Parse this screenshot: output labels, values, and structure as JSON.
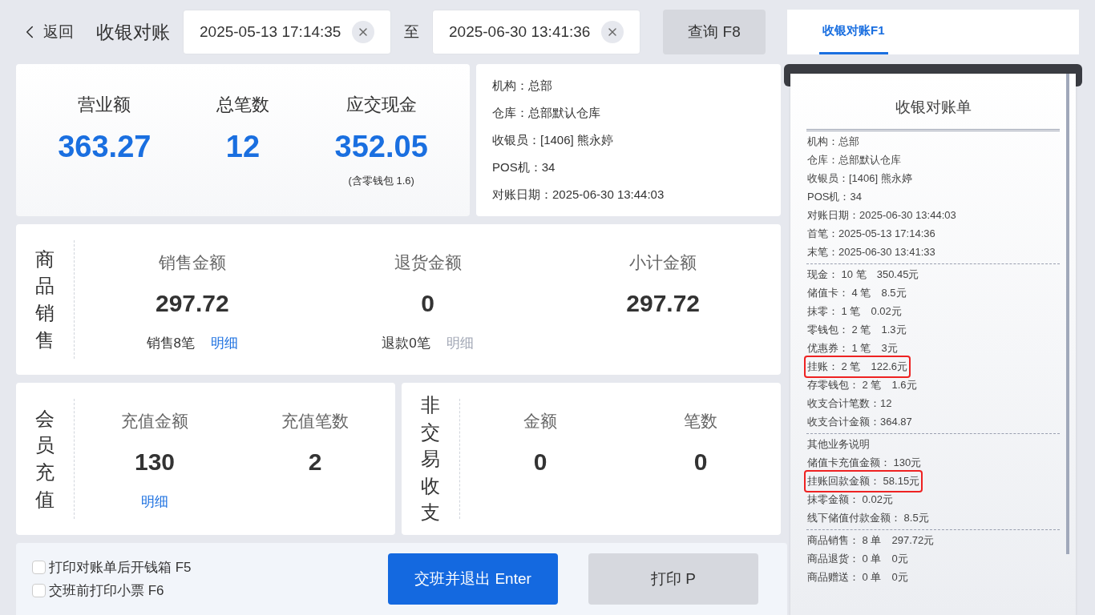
{
  "header": {
    "back": "返回",
    "title": "收银对账",
    "date_from": "2025-05-13 17:14:35",
    "separator": "至",
    "date_to": "2025-06-30 13:41:36",
    "query_button": "查询 F8"
  },
  "summary": [
    {
      "label": "营业额",
      "value": "363.27"
    },
    {
      "label": "总笔数",
      "value": "12"
    },
    {
      "label": "应交现金",
      "value": "352.05",
      "note": "(含零钱包 1.6)"
    }
  ],
  "info": [
    "机构：总部",
    "仓库：总部默认仓库",
    "收银员：[1406] 熊永婷",
    "POS机：34",
    "对账日期：2025-06-30 13:44:03"
  ],
  "goods_sales": {
    "label": "商品销售",
    "columns": [
      {
        "label": "销售金额",
        "value": "297.72",
        "count": "销售8笔",
        "link": "明细",
        "disabled": false
      },
      {
        "label": "退货金额",
        "value": "0",
        "count": "退款0笔",
        "link": "明细",
        "disabled": true
      },
      {
        "label": "小计金额",
        "value": "297.72"
      }
    ]
  },
  "member_recharge": {
    "label": "会员充值",
    "columns": [
      {
        "label": "充值金额",
        "value": "130",
        "link": "明细",
        "disabled": false
      },
      {
        "label": "充值笔数",
        "value": "2"
      }
    ]
  },
  "non_trade": {
    "label": "非交易收支",
    "columns": [
      {
        "label": "金额",
        "value": "0"
      },
      {
        "label": "笔数",
        "value": "0"
      }
    ]
  },
  "options": [
    {
      "label": "打印对账单后开钱箱 F5",
      "checked": false
    },
    {
      "label": "交班前打印小票 F6",
      "checked": false
    }
  ],
  "buttons": [
    {
      "label": "交班并退出 Enter",
      "kind": "primary"
    },
    {
      "label": "打印 P",
      "kind": "secondary"
    }
  ],
  "tabs": [
    {
      "label": "收银对账F1",
      "selected": true
    }
  ],
  "receipt": {
    "title": "收银对账单",
    "sections": [
      {
        "lines": [
          {
            "text": "机构：总部",
            "highlighted": false
          },
          {
            "text": "仓库：总部默认仓库",
            "highlighted": false
          },
          {
            "text": "收银员：[1406] 熊永婷",
            "highlighted": false
          },
          {
            "text": "POS机：34",
            "highlighted": false
          },
          {
            "text": "对账日期：2025-06-30 13:44:03",
            "highlighted": false
          },
          {
            "text": "首笔：2025-05-13 17:14:36",
            "highlighted": false
          },
          {
            "text": "末笔：2025-06-30 13:41:33",
            "highlighted": false
          }
        ]
      },
      {
        "lines": [
          {
            "text": "现金： 10 笔　350.45元",
            "highlighted": false
          },
          {
            "text": "储值卡： 4 笔　8.5元",
            "highlighted": false
          },
          {
            "text": "抹零： 1 笔　0.02元",
            "highlighted": false
          },
          {
            "text": "零钱包： 2 笔　1.3元",
            "highlighted": false
          },
          {
            "text": "优惠券： 1 笔　3元",
            "highlighted": false
          },
          {
            "text": "挂账： 2 笔　122.6元",
            "highlighted": true
          },
          {
            "text": "存零钱包： 2 笔　1.6元",
            "highlighted": false
          },
          {
            "text": "收支合计笔数：12",
            "highlighted": false
          },
          {
            "text": "收支合计金额：364.87",
            "highlighted": false
          }
        ]
      },
      {
        "lines": [
          {
            "text": "其他业务说明",
            "highlighted": false
          },
          {
            "text": "储值卡充值金额： 130元",
            "highlighted": false
          },
          {
            "text": "挂账回款金额： 58.15元",
            "highlighted": true
          },
          {
            "text": "抹零金额： 0.02元",
            "highlighted": false
          },
          {
            "text": "线下储值付款金额： 8.5元",
            "highlighted": false
          }
        ]
      },
      {
        "lines": [
          {
            "text": "商品销售： 8 单　297.72元",
            "highlighted": false
          },
          {
            "text": "商品退货： 0 单　0元",
            "highlighted": false
          },
          {
            "text": "商品赠送： 0 单　0元",
            "highlighted": false
          }
        ]
      }
    ]
  }
}
